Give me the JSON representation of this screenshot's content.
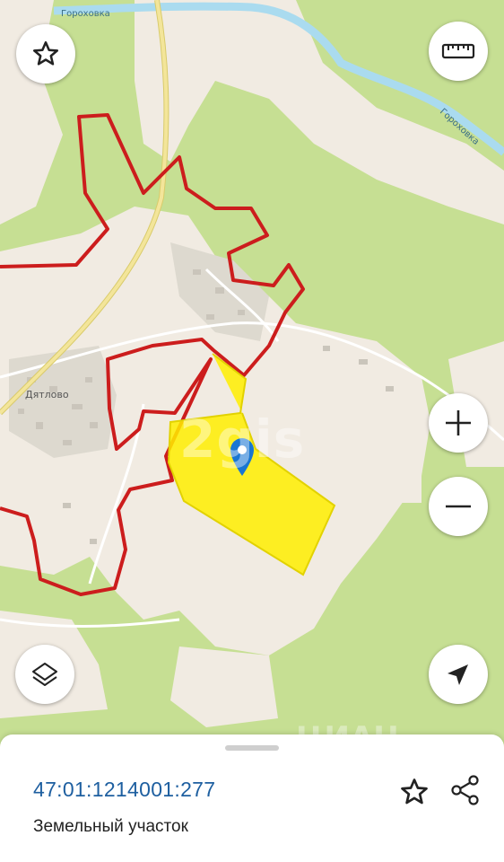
{
  "map": {
    "place_labels": {
      "village": "Дятлово",
      "river_top": "Гороховка",
      "river_right": "Гороховка"
    },
    "watermark": "2gis",
    "watermark_bottom": "ЦИАН",
    "colors": {
      "forest": "#c6df93",
      "open_land": "#f1ebe2",
      "road": "#ffffff",
      "main_road": "#f3e59a",
      "river": "#aadbef",
      "boundary": "#cc1d1d",
      "parcel_fill": "#ffee00",
      "pin": "#1976d2"
    }
  },
  "controls": {
    "favorite": "star-icon",
    "ruler": "ruler-icon",
    "zoom_in": "plus-icon",
    "zoom_out": "minus-icon",
    "layers": "layers-icon",
    "locate": "navigation-arrow-icon"
  },
  "panel": {
    "parcel_id": "47:01:1214001:277",
    "parcel_type": "Земельный участок",
    "favorite_icon": "star-icon",
    "share_icon": "share-icon"
  }
}
